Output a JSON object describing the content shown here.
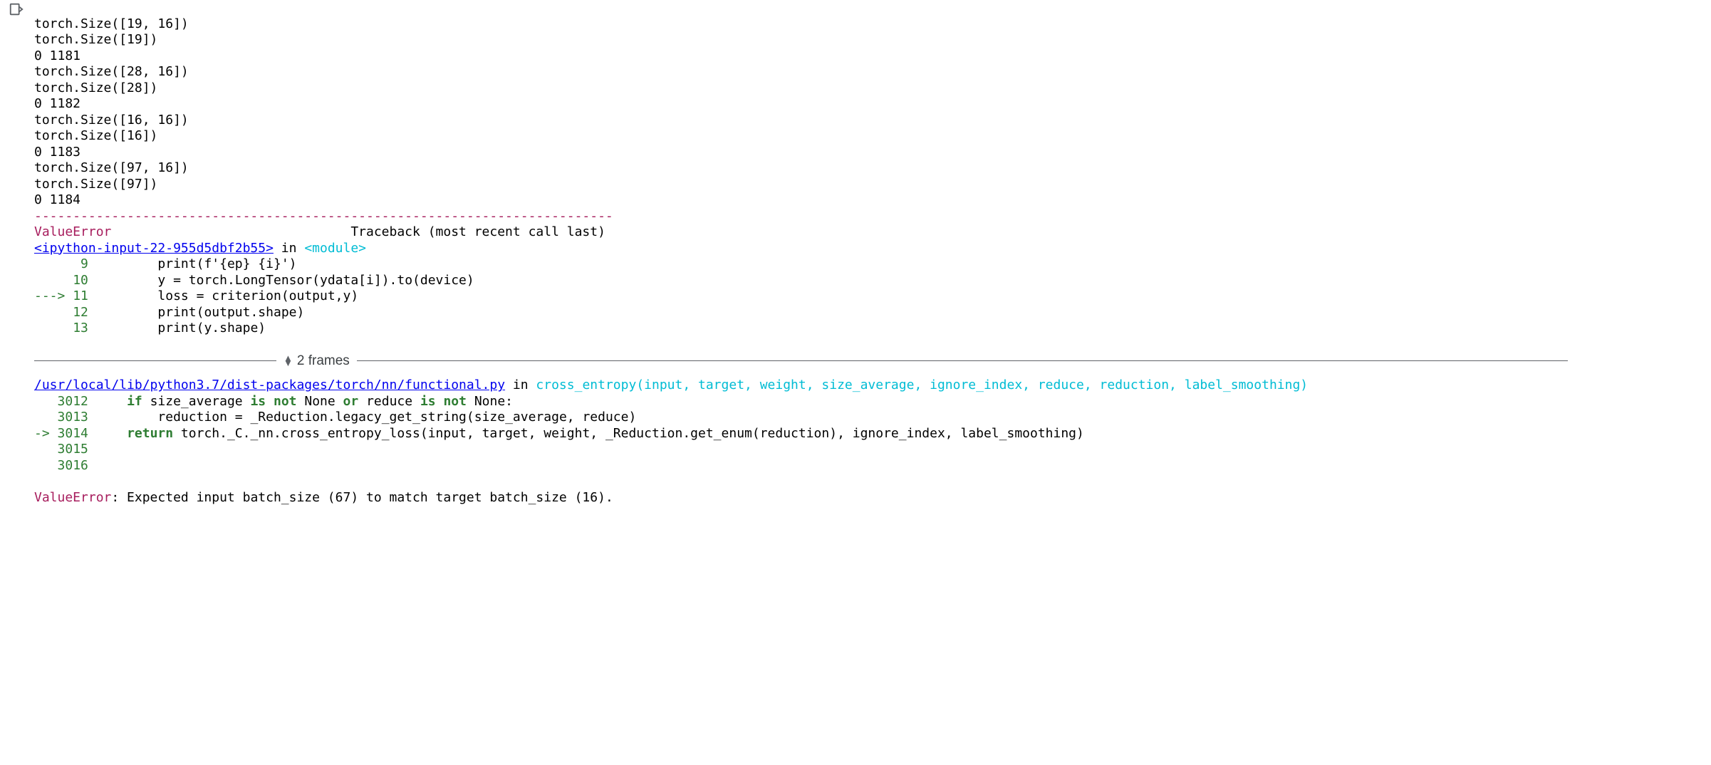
{
  "stdout": [
    "torch.Size([19, 16])",
    "torch.Size([19])",
    "0 1181",
    "torch.Size([28, 16])",
    "torch.Size([28])",
    "0 1182",
    "torch.Size([16, 16])",
    "torch.Size([16])",
    "0 1183",
    "torch.Size([97, 16])",
    "torch.Size([97])",
    "0 1184"
  ],
  "traceback": {
    "separator": "---------------------------------------------------------------------------",
    "error_name": "ValueError",
    "recent_call": "                               Traceback (most recent call last)",
    "frame1": {
      "link": "<ipython-input-22-955d5dbf2b55>",
      "in_word": " in ",
      "module": "<module>",
      "lines": [
        {
          "arrow": "      ",
          "no": "9",
          "pad": "         ",
          "code": "print(f'{ep} {i}')"
        },
        {
          "arrow": "     ",
          "no": "10",
          "pad": "         ",
          "code": "y = torch.LongTensor(ydata[i]).to(device)"
        },
        {
          "arrow": "---> ",
          "no": "11",
          "pad": "         ",
          "code": "loss = criterion(output,y)"
        },
        {
          "arrow": "     ",
          "no": "12",
          "pad": "         ",
          "code": "print(output.shape)"
        },
        {
          "arrow": "     ",
          "no": "13",
          "pad": "         ",
          "code": "print(y.shape)"
        }
      ]
    },
    "frames_toggle": {
      "label": "2 frames"
    },
    "frame2": {
      "link": "/usr/local/lib/python3.7/dist-packages/torch/nn/functional.py",
      "in_word": " in ",
      "func": "cross_entropy",
      "sig": "(input, target, weight, size_average, ignore_index, reduce, reduction, label_smoothing)",
      "lines": [
        {
          "arrow": "   ",
          "no": "3012",
          "pad": "     ",
          "code_pre": "",
          "kw1": "if",
          "code_mid1": " size_average ",
          "kw2": "is",
          "code_mid2": " ",
          "kw3": "not",
          "code_mid3": " None ",
          "kw4": "or",
          "code_mid4": " reduce ",
          "kw5": "is",
          "code_mid5": " ",
          "kw6": "not",
          "code_post": " None:"
        },
        {
          "arrow": "   ",
          "no": "3013",
          "pad": "         ",
          "code": "reduction = _Reduction.legacy_get_string(size_average, reduce)"
        },
        {
          "arrow": "-> ",
          "no": "3014",
          "pad": "     ",
          "kw": "return",
          "code": " torch._C._nn.cross_entropy_loss(input, target, weight, _Reduction.get_enum(reduction), ignore_index, label_smoothing)"
        },
        {
          "arrow": "   ",
          "no": "3015",
          "pad": "",
          "code": ""
        },
        {
          "arrow": "   ",
          "no": "3016",
          "pad": "",
          "code": ""
        }
      ]
    },
    "final": {
      "name": "ValueError",
      "msg": ": Expected input batch_size (67) to match target batch_size (16)."
    }
  }
}
